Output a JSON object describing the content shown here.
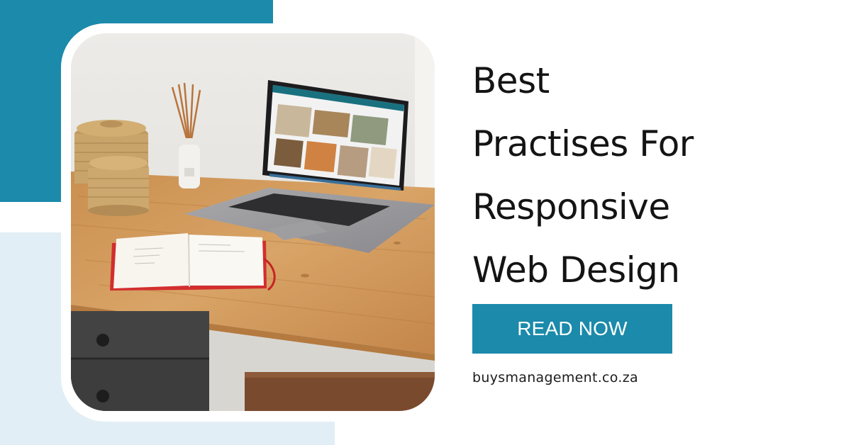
{
  "headline": {
    "lines": [
      "Best",
      "Practises For",
      "Responsive",
      "Web Design"
    ]
  },
  "cta": {
    "label": "READ NOW"
  },
  "website": "buysmanagement.co.za",
  "colors": {
    "accent": "#1b8aab",
    "light_panel": "#e1eef5",
    "text": "#141414"
  },
  "photo": {
    "icons": [
      "laptop-icon",
      "notebook-icon",
      "wicker-basket-icon",
      "reed-diffuser-icon",
      "desk-icon"
    ]
  }
}
